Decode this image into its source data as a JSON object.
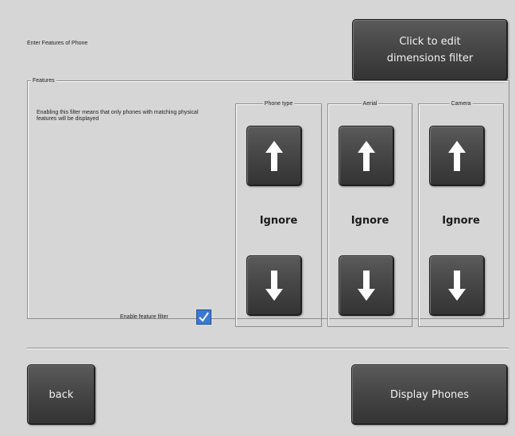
{
  "header": {
    "prompt": "Enter Features of Phone",
    "dimensions_button_label": "Click to edit dimensions filter"
  },
  "features": {
    "group_label": "Features",
    "description": "Enabling this filter means that only phones with matching physical features will be displayed",
    "enable_label": "Enable feature filter",
    "enable_checked": true,
    "columns": [
      {
        "label": "Phone type",
        "value": "Ignore",
        "up_icon": "up-arrow-icon",
        "down_icon": "down-arrow-icon"
      },
      {
        "label": "Aerial",
        "value": "Ignore",
        "up_icon": "up-arrow-icon",
        "down_icon": "down-arrow-icon"
      },
      {
        "label": "Camera",
        "value": "Ignore",
        "up_icon": "up-arrow-icon",
        "down_icon": "down-arrow-icon"
      }
    ]
  },
  "footer": {
    "back_label": "back",
    "display_label": "Display Phones"
  },
  "colors": {
    "background": "#d6d6d6",
    "button": "#474747",
    "checkbox_accent": "#3a78d4"
  }
}
